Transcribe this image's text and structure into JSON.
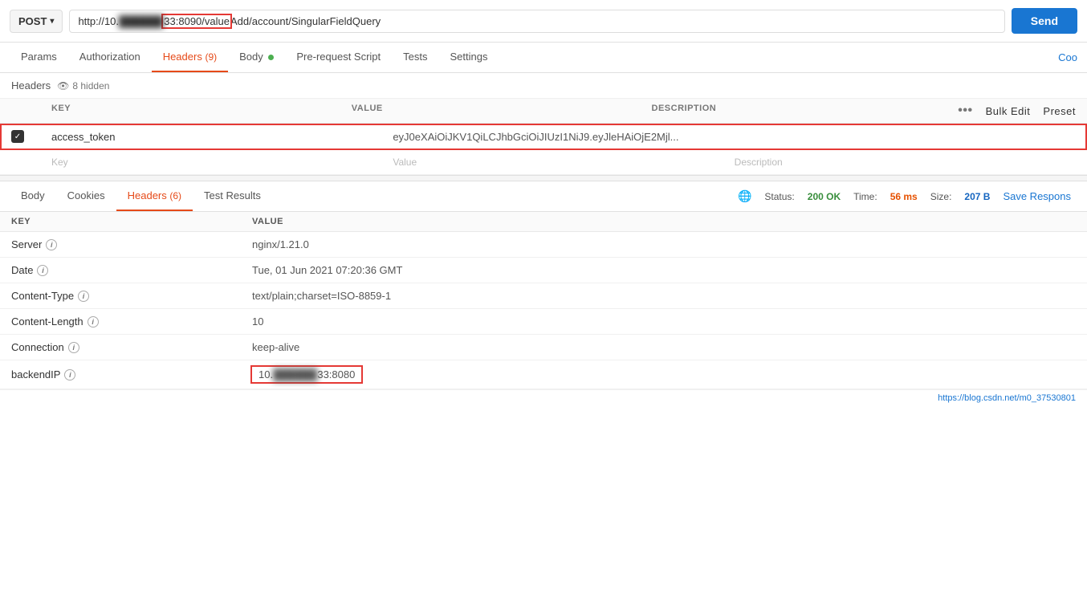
{
  "urlBar": {
    "method": "POST",
    "urlPrefix": "http://10.",
    "urlMiddle": "33:8090/value",
    "urlSuffix": "Add/account/SingularFieldQuery",
    "sendLabel": "Send"
  },
  "requestTabs": [
    {
      "id": "params",
      "label": "Params",
      "active": false
    },
    {
      "id": "authorization",
      "label": "Authorization",
      "active": false
    },
    {
      "id": "headers",
      "label": "Headers",
      "active": true,
      "badge": "(9)"
    },
    {
      "id": "body",
      "label": "Body",
      "active": false,
      "dot": true
    },
    {
      "id": "prerequest",
      "label": "Pre-request Script",
      "active": false
    },
    {
      "id": "tests",
      "label": "Tests",
      "active": false
    },
    {
      "id": "settings",
      "label": "Settings",
      "active": false
    }
  ],
  "cookiesLabel": "Coo",
  "headersSection": {
    "label": "Headers",
    "hiddenCount": "8 hidden"
  },
  "requestTable": {
    "columns": [
      "",
      "KEY",
      "VALUE",
      "DESCRIPTION",
      "",
      ""
    ],
    "bulkEditLabel": "Bulk Edit",
    "presetLabel": "Preset",
    "rows": [
      {
        "checked": true,
        "key": "access_token",
        "value": "eyJ0eXAiOiJKV1QiLCJhbGciOiJIUzI1NiJ9.eyJleHAiOjE2Mjl...",
        "description": "",
        "highlighted": true
      }
    ],
    "emptyRow": {
      "key": "Key",
      "value": "Value",
      "description": "Description"
    }
  },
  "responseTabs": [
    {
      "id": "body",
      "label": "Body",
      "active": false
    },
    {
      "id": "cookies",
      "label": "Cookies",
      "active": false
    },
    {
      "id": "headers",
      "label": "Headers",
      "active": true,
      "badge": "(6)"
    },
    {
      "id": "testresults",
      "label": "Test Results",
      "active": false
    }
  ],
  "responseStatus": {
    "statusLabel": "Status:",
    "statusValue": "200 OK",
    "timeLabel": "Time:",
    "timeValue": "56 ms",
    "sizeLabel": "Size:",
    "sizeValue": "207 B",
    "saveLabel": "Save Respons"
  },
  "responseTable": {
    "columns": [
      "KEY",
      "VALUE"
    ],
    "rows": [
      {
        "key": "Server",
        "value": "nginx/1.21.0",
        "highlighted": false
      },
      {
        "key": "Date",
        "value": "Tue, 01 Jun 2021 07:20:36 GMT",
        "highlighted": false
      },
      {
        "key": "Content-Type",
        "value": "text/plain;charset=ISO-8859-1",
        "highlighted": false
      },
      {
        "key": "Content-Length",
        "value": "10",
        "highlighted": false
      },
      {
        "key": "Connection",
        "value": "keep-alive",
        "highlighted": false
      },
      {
        "key": "backendIP",
        "valuePrefix": "10.",
        "valueSuffix": "33:8080",
        "highlighted": true
      }
    ]
  },
  "footerLink": "https://blog.csdn.net/m0_37530801"
}
